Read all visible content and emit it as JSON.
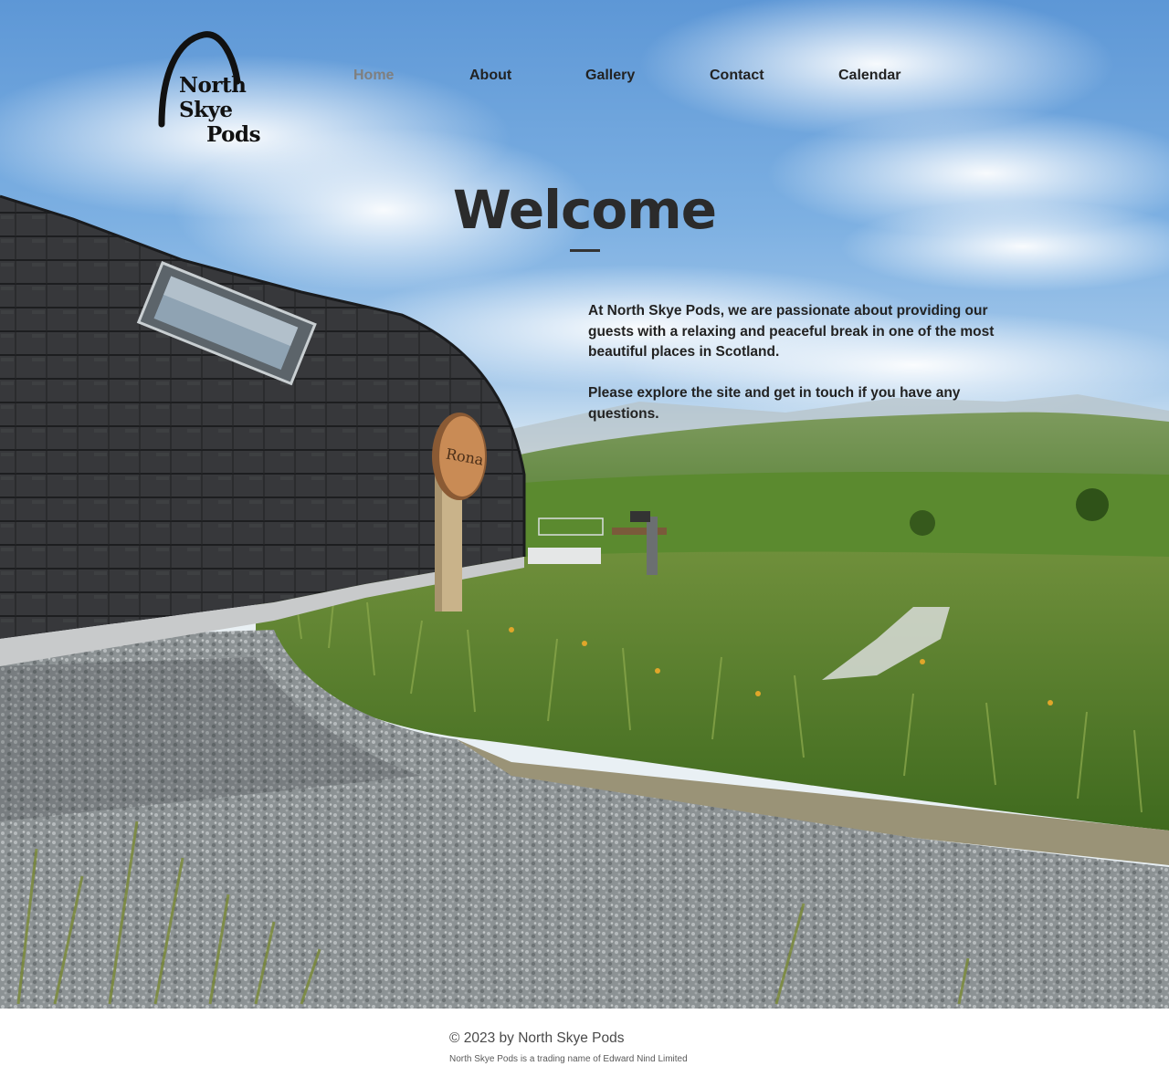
{
  "brand": {
    "logo_line1": "North Skye",
    "logo_line2": "Pods"
  },
  "nav": {
    "items": [
      {
        "label": "Home",
        "active": true
      },
      {
        "label": "About",
        "active": false
      },
      {
        "label": "Gallery",
        "active": false
      },
      {
        "label": "Contact",
        "active": false
      },
      {
        "label": "Calendar",
        "active": false
      }
    ]
  },
  "hero": {
    "title": "Welcome",
    "paragraphs": [
      "At North Skye Pods, we are passionate about providing our guests with a relaxing and peaceful break in one of the most beautiful places in Scotland.",
      "Please explore the site and get in touch if you have any questions."
    ],
    "sign_text": "Rona"
  },
  "footer": {
    "copyright": "© 2023 by North Skye Pods",
    "trading_note": "North Skye Pods is a trading name of Edward Nind Limited"
  },
  "colors": {
    "nav_active": "#7f7f7f",
    "nav_default": "#222222",
    "title": "#2b2b2b"
  }
}
